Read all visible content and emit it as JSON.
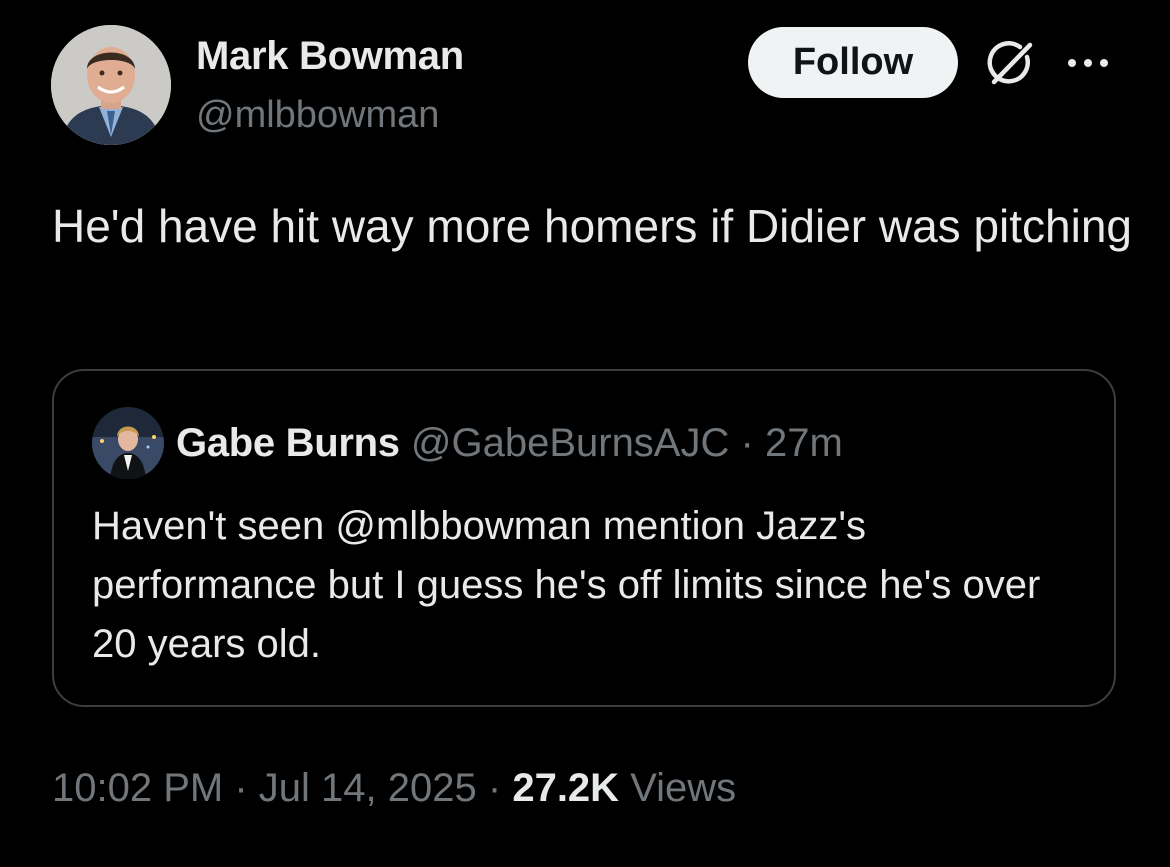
{
  "author": {
    "name": "Mark Bowman",
    "handle": "@mlbbowman"
  },
  "actions": {
    "follow_label": "Follow",
    "grok_icon": "grok-icon",
    "more_icon": "more-icon"
  },
  "tweet": {
    "text": "He'd have hit way more homers if Didier was pitching"
  },
  "quote": {
    "name": "Gabe Burns",
    "handle": "@GabeBurnsAJC",
    "separator": "·",
    "time": "27m",
    "text": "Haven't seen @mlbbowman mention Jazz's performance but I guess he's off limits since he's over 20 years old."
  },
  "meta": {
    "time": "10:02 PM",
    "sep1": "·",
    "date": "Jul 14, 2025",
    "sep2": "·",
    "views_count": "27.2K",
    "views_label": "Views"
  },
  "colors": {
    "background": "#000000",
    "primary_text": "#e7e9ea",
    "secondary_text": "#71767b",
    "follow_bg": "#eff3f4",
    "border": "#3a3d41"
  }
}
